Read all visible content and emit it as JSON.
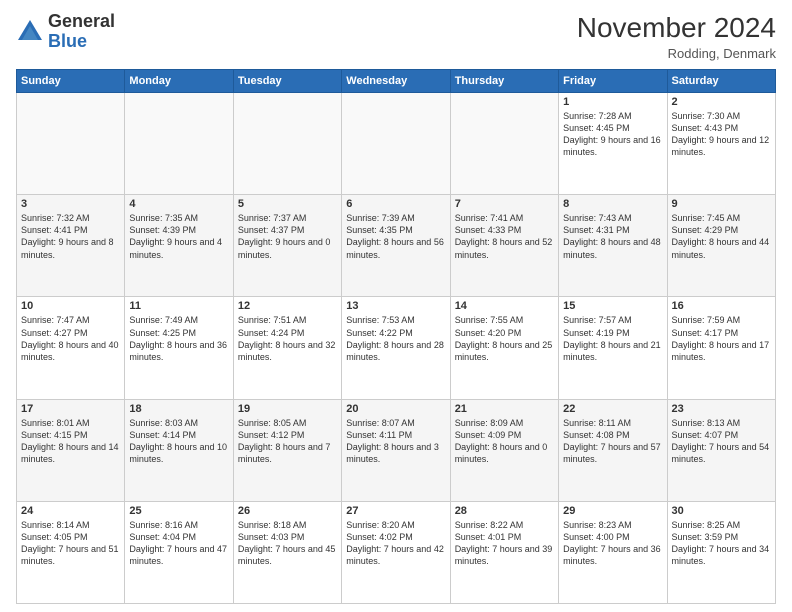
{
  "logo": {
    "general": "General",
    "blue": "Blue"
  },
  "header": {
    "month": "November 2024",
    "location": "Rodding, Denmark"
  },
  "days_of_week": [
    "Sunday",
    "Monday",
    "Tuesday",
    "Wednesday",
    "Thursday",
    "Friday",
    "Saturday"
  ],
  "weeks": [
    [
      {
        "day": "",
        "info": ""
      },
      {
        "day": "",
        "info": ""
      },
      {
        "day": "",
        "info": ""
      },
      {
        "day": "",
        "info": ""
      },
      {
        "day": "",
        "info": ""
      },
      {
        "day": "1",
        "info": "Sunrise: 7:28 AM\nSunset: 4:45 PM\nDaylight: 9 hours\nand 16 minutes."
      },
      {
        "day": "2",
        "info": "Sunrise: 7:30 AM\nSunset: 4:43 PM\nDaylight: 9 hours\nand 12 minutes."
      }
    ],
    [
      {
        "day": "3",
        "info": "Sunrise: 7:32 AM\nSunset: 4:41 PM\nDaylight: 9 hours\nand 8 minutes."
      },
      {
        "day": "4",
        "info": "Sunrise: 7:35 AM\nSunset: 4:39 PM\nDaylight: 9 hours\nand 4 minutes."
      },
      {
        "day": "5",
        "info": "Sunrise: 7:37 AM\nSunset: 4:37 PM\nDaylight: 9 hours\nand 0 minutes."
      },
      {
        "day": "6",
        "info": "Sunrise: 7:39 AM\nSunset: 4:35 PM\nDaylight: 8 hours\nand 56 minutes."
      },
      {
        "day": "7",
        "info": "Sunrise: 7:41 AM\nSunset: 4:33 PM\nDaylight: 8 hours\nand 52 minutes."
      },
      {
        "day": "8",
        "info": "Sunrise: 7:43 AM\nSunset: 4:31 PM\nDaylight: 8 hours\nand 48 minutes."
      },
      {
        "day": "9",
        "info": "Sunrise: 7:45 AM\nSunset: 4:29 PM\nDaylight: 8 hours\nand 44 minutes."
      }
    ],
    [
      {
        "day": "10",
        "info": "Sunrise: 7:47 AM\nSunset: 4:27 PM\nDaylight: 8 hours\nand 40 minutes."
      },
      {
        "day": "11",
        "info": "Sunrise: 7:49 AM\nSunset: 4:25 PM\nDaylight: 8 hours\nand 36 minutes."
      },
      {
        "day": "12",
        "info": "Sunrise: 7:51 AM\nSunset: 4:24 PM\nDaylight: 8 hours\nand 32 minutes."
      },
      {
        "day": "13",
        "info": "Sunrise: 7:53 AM\nSunset: 4:22 PM\nDaylight: 8 hours\nand 28 minutes."
      },
      {
        "day": "14",
        "info": "Sunrise: 7:55 AM\nSunset: 4:20 PM\nDaylight: 8 hours\nand 25 minutes."
      },
      {
        "day": "15",
        "info": "Sunrise: 7:57 AM\nSunset: 4:19 PM\nDaylight: 8 hours\nand 21 minutes."
      },
      {
        "day": "16",
        "info": "Sunrise: 7:59 AM\nSunset: 4:17 PM\nDaylight: 8 hours\nand 17 minutes."
      }
    ],
    [
      {
        "day": "17",
        "info": "Sunrise: 8:01 AM\nSunset: 4:15 PM\nDaylight: 8 hours\nand 14 minutes."
      },
      {
        "day": "18",
        "info": "Sunrise: 8:03 AM\nSunset: 4:14 PM\nDaylight: 8 hours\nand 10 minutes."
      },
      {
        "day": "19",
        "info": "Sunrise: 8:05 AM\nSunset: 4:12 PM\nDaylight: 8 hours\nand 7 minutes."
      },
      {
        "day": "20",
        "info": "Sunrise: 8:07 AM\nSunset: 4:11 PM\nDaylight: 8 hours\nand 3 minutes."
      },
      {
        "day": "21",
        "info": "Sunrise: 8:09 AM\nSunset: 4:09 PM\nDaylight: 8 hours\nand 0 minutes."
      },
      {
        "day": "22",
        "info": "Sunrise: 8:11 AM\nSunset: 4:08 PM\nDaylight: 7 hours\nand 57 minutes."
      },
      {
        "day": "23",
        "info": "Sunrise: 8:13 AM\nSunset: 4:07 PM\nDaylight: 7 hours\nand 54 minutes."
      }
    ],
    [
      {
        "day": "24",
        "info": "Sunrise: 8:14 AM\nSunset: 4:05 PM\nDaylight: 7 hours\nand 51 minutes."
      },
      {
        "day": "25",
        "info": "Sunrise: 8:16 AM\nSunset: 4:04 PM\nDaylight: 7 hours\nand 47 minutes."
      },
      {
        "day": "26",
        "info": "Sunrise: 8:18 AM\nSunset: 4:03 PM\nDaylight: 7 hours\nand 45 minutes."
      },
      {
        "day": "27",
        "info": "Sunrise: 8:20 AM\nSunset: 4:02 PM\nDaylight: 7 hours\nand 42 minutes."
      },
      {
        "day": "28",
        "info": "Sunrise: 8:22 AM\nSunset: 4:01 PM\nDaylight: 7 hours\nand 39 minutes."
      },
      {
        "day": "29",
        "info": "Sunrise: 8:23 AM\nSunset: 4:00 PM\nDaylight: 7 hours\nand 36 minutes."
      },
      {
        "day": "30",
        "info": "Sunrise: 8:25 AM\nSunset: 3:59 PM\nDaylight: 7 hours\nand 34 minutes."
      }
    ]
  ]
}
